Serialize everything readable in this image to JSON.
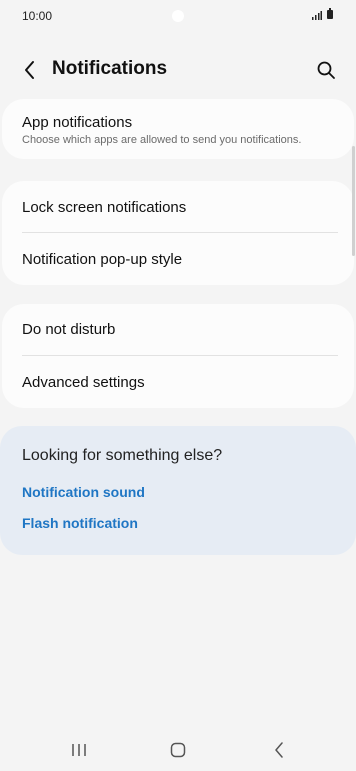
{
  "status_bar": {
    "time": "10:00"
  },
  "header": {
    "title": "Notifications",
    "back_icon": "chevron-left-icon",
    "search_icon": "search-icon"
  },
  "app_notifications": {
    "title": "App notifications",
    "subtitle": "Choose which apps are allowed to send you notifications."
  },
  "lock_group": {
    "items": [
      {
        "label": "Lock screen notifications"
      },
      {
        "label": "Notification pop-up style"
      }
    ]
  },
  "dnd_group": {
    "items": [
      {
        "label": "Do not disturb"
      },
      {
        "label": "Advanced settings"
      }
    ]
  },
  "suggestions": {
    "heading": "Looking for something else?",
    "links": [
      {
        "label": "Notification sound"
      },
      {
        "label": "Flash notification"
      }
    ]
  },
  "nav_bar": {
    "recents_icon": "recents-icon",
    "home_icon": "home-icon",
    "back_icon": "back-icon"
  },
  "colors": {
    "link": "#1f76c4",
    "card": "#fcfcfc",
    "background": "#f4f4f4",
    "suggest_bg": "#e6ecf4"
  }
}
